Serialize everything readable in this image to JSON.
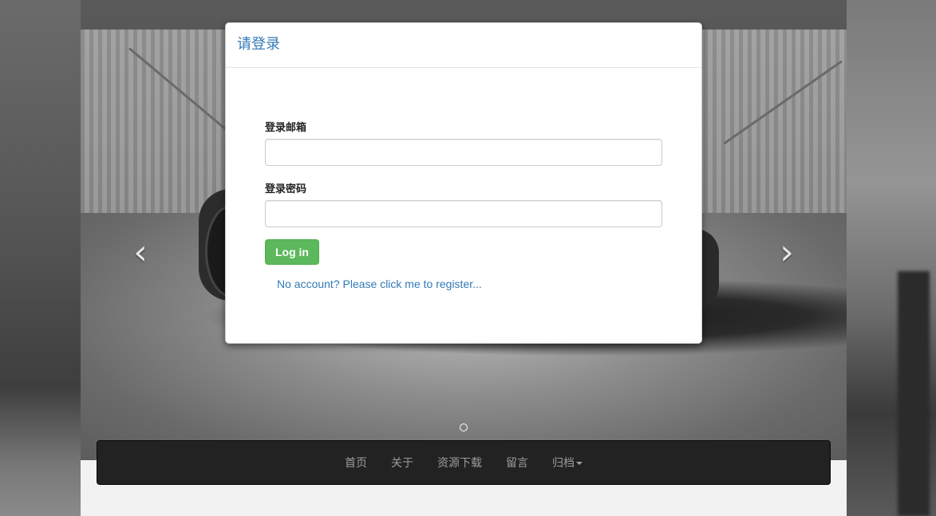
{
  "modal": {
    "title": "请登录",
    "email_label": "登录邮箱",
    "email_value": "",
    "password_label": "登录密码",
    "password_value": "",
    "login_button": "Log in",
    "register_link": "No account? Please click me to register..."
  },
  "carousel": {
    "prev_icon": "chevron-left-icon",
    "next_icon": "chevron-right-icon",
    "indicator_count": 1
  },
  "nav": {
    "items": [
      {
        "label": "首页"
      },
      {
        "label": "关于"
      },
      {
        "label": "资源下载"
      },
      {
        "label": "留言"
      },
      {
        "label": "归档"
      }
    ]
  },
  "colors": {
    "accent": "#337ab7",
    "success": "#5cb85c",
    "navbar_bg": "#222222",
    "nav_text": "#9d9d9d"
  }
}
